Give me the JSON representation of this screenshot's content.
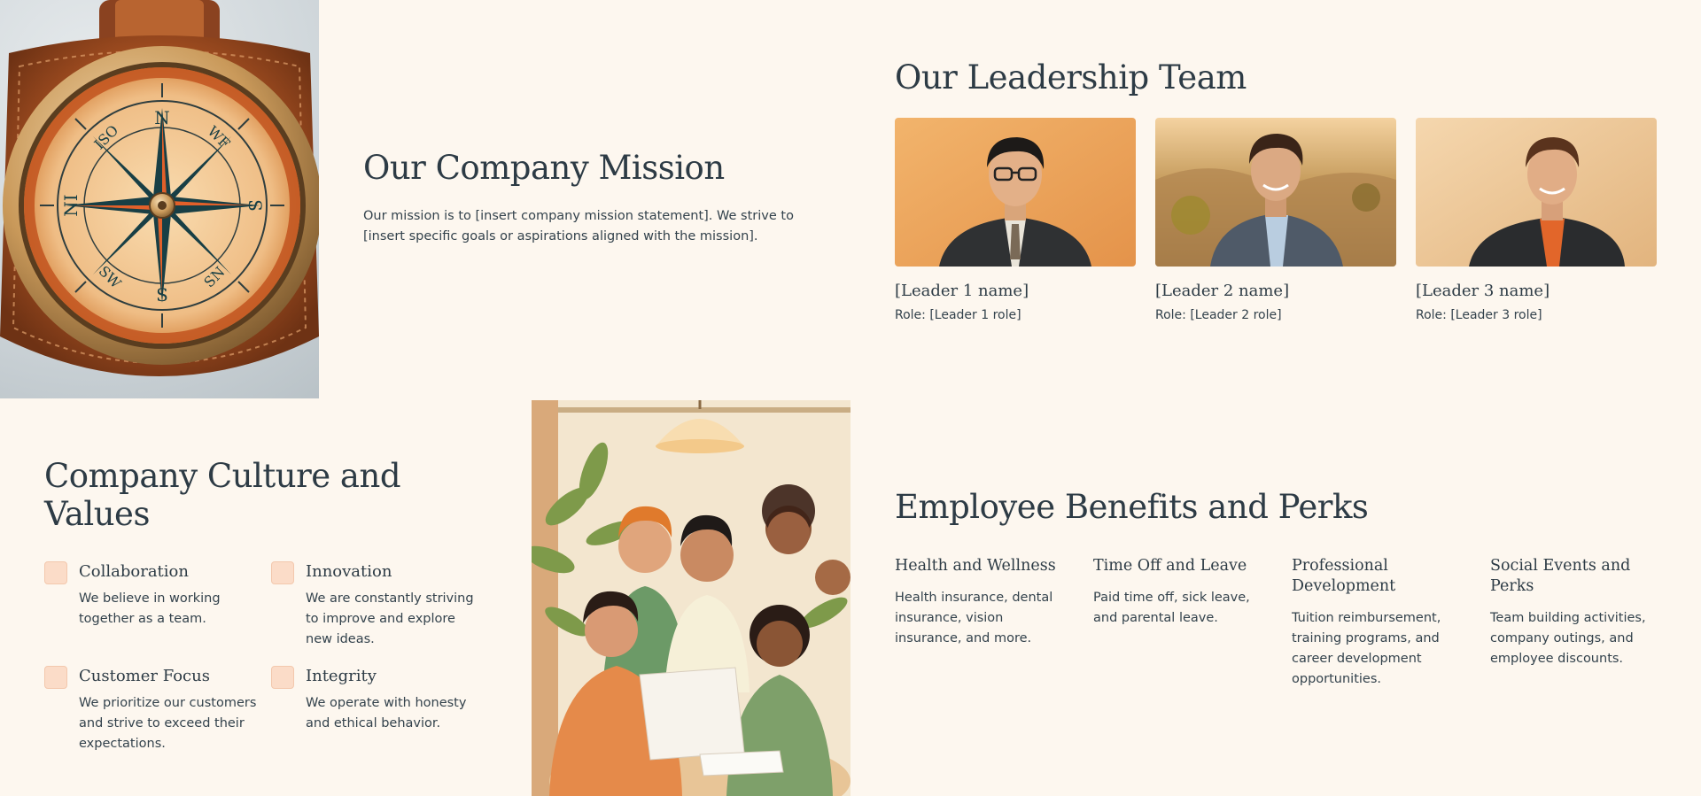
{
  "mission": {
    "title": "Our Company Mission",
    "text": "Our mission is to [insert company mission statement]. We strive to [insert specific goals or aspirations aligned with the mission]."
  },
  "leadership": {
    "title": "Our Leadership Team",
    "leaders": [
      {
        "name": "[Leader 1 name]",
        "role": "Role: [Leader 1 role]"
      },
      {
        "name": "[Leader 2 name]",
        "role": "Role: [Leader 2 role]"
      },
      {
        "name": "[Leader 3 name]",
        "role": "Role: [Leader 3 role]"
      }
    ]
  },
  "culture": {
    "title": "Company Culture and Values",
    "values": [
      {
        "title": "Collaboration",
        "desc": "We believe in working together as a team."
      },
      {
        "title": "Innovation",
        "desc": "We are constantly striving to improve and explore new ideas."
      },
      {
        "title": "Customer Focus",
        "desc": "We prioritize our customers and strive to exceed their expectations."
      },
      {
        "title": "Integrity",
        "desc": "We operate with honesty and ethical behavior."
      }
    ]
  },
  "benefits": {
    "title": "Employee Benefits and Perks",
    "perks": [
      {
        "title": "Health and Wellness",
        "desc": "Health insurance, dental insurance, vision insurance, and more."
      },
      {
        "title": "Time Off and Leave",
        "desc": "Paid time off, sick leave, and parental leave."
      },
      {
        "title": "Professional Development",
        "desc": "Tuition reimbursement, training programs, and career development opportunities."
      },
      {
        "title": "Social Events and Perks",
        "desc": "Team building activities, company outings, and employee discounts."
      }
    ]
  },
  "compass_letters": {
    "n": "N",
    "s": "S",
    "e": "S",
    "w": "NI",
    "nw": "ISO",
    "ne": "WF",
    "sw": "SW",
    "se": "SN"
  },
  "colors": {
    "background": "#fdf7ef",
    "heading": "#2d3b45",
    "value_box": "#fbdcc8",
    "accent": "#e1602a"
  }
}
